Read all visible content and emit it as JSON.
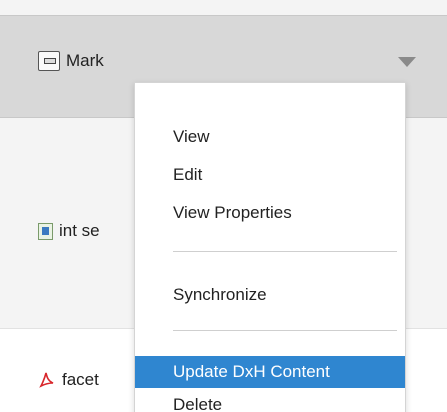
{
  "list": {
    "items": [
      {
        "label": "Mark",
        "icon": "script-icon"
      },
      {
        "label": "int se",
        "icon": "document-icon"
      },
      {
        "label": "facet",
        "icon": "pdf-icon"
      }
    ]
  },
  "menu": {
    "items": [
      {
        "label": "View"
      },
      {
        "label": "Edit"
      },
      {
        "label": "View Properties"
      },
      {
        "label": "Synchronize"
      },
      {
        "label": "Update DxH Content",
        "highlighted": true
      },
      {
        "label": "Delete"
      }
    ]
  },
  "colors": {
    "highlight": "#2f86d0",
    "selected_row": "#d8d8d8"
  }
}
